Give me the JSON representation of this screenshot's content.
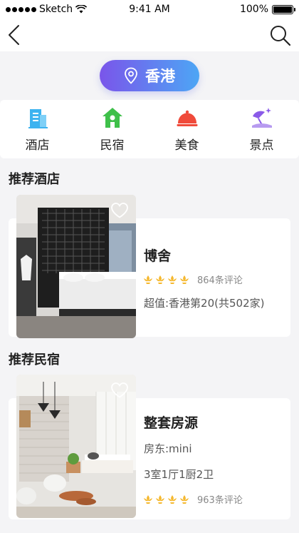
{
  "status_bar": {
    "carrier": "Sketch",
    "time": "9:41 AM",
    "battery": "100%"
  },
  "location": {
    "city": "香港"
  },
  "categories": [
    {
      "label": "酒店",
      "icon": "hotel-icon",
      "color": "#3db3f0"
    },
    {
      "label": "民宿",
      "icon": "guesthouse-icon",
      "color": "#3fc04a"
    },
    {
      "label": "美食",
      "icon": "food-icon",
      "color": "#f04a3a"
    },
    {
      "label": "景点",
      "icon": "scenic-icon",
      "color": "#8a5ae8"
    }
  ],
  "sections": {
    "hotels_title": "推荐酒店",
    "homestays_title": "推荐民宿"
  },
  "hotel": {
    "name": "博舍",
    "rating": 4,
    "reviews": "864条评论",
    "rank": "超值:香港第20(共502家)"
  },
  "homestay": {
    "name": "整套房源",
    "host": "房东:mini",
    "layout": "3室1厅1厨2卫",
    "rating": 4,
    "reviews": "963条评论"
  },
  "colors": {
    "accent_start": "#7a55ea",
    "accent_end": "#4da6f5",
    "rating": "#f5b82e"
  }
}
